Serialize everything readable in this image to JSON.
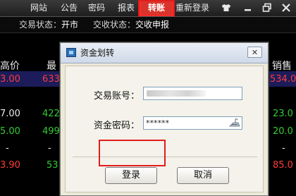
{
  "menu": {
    "items": [
      "网站",
      "公告",
      "密码",
      "报表",
      "转账",
      "重新登录"
    ],
    "active_label": "转账",
    "window_buttons": [
      "shirt-icon",
      "minimize-icon",
      "restore-icon",
      "close-icon"
    ]
  },
  "status": {
    "trade_label": "交易状态：",
    "trade_value": "开市",
    "settle_label": "交收状态：",
    "settle_value": "交收申报"
  },
  "table": {
    "headers": [
      "高价",
      "最",
      "销售价"
    ],
    "left_values": [
      "3.00",
      "7.00",
      "5.00",
      "-",
      "3.90"
    ],
    "mid_values": [
      "633",
      "422",
      "499",
      "-",
      "53"
    ],
    "right_values": [
      "534.0",
      "23.0",
      "20.0",
      "-",
      "85.0"
    ],
    "colors": {
      "red": "#ff3b3b",
      "green": "#33cc33",
      "white": "#e8e8e8"
    }
  },
  "dialog": {
    "title": "资金划转",
    "close_glyph": "✕",
    "account_label": "交易账号：",
    "account_value": "",
    "password_label": "资金密码：",
    "password_value": "******",
    "login_label": "登录",
    "cancel_label": "取消"
  },
  "accent": {
    "highlight": "#e21c1c",
    "active_tab": "#d9342b"
  }
}
